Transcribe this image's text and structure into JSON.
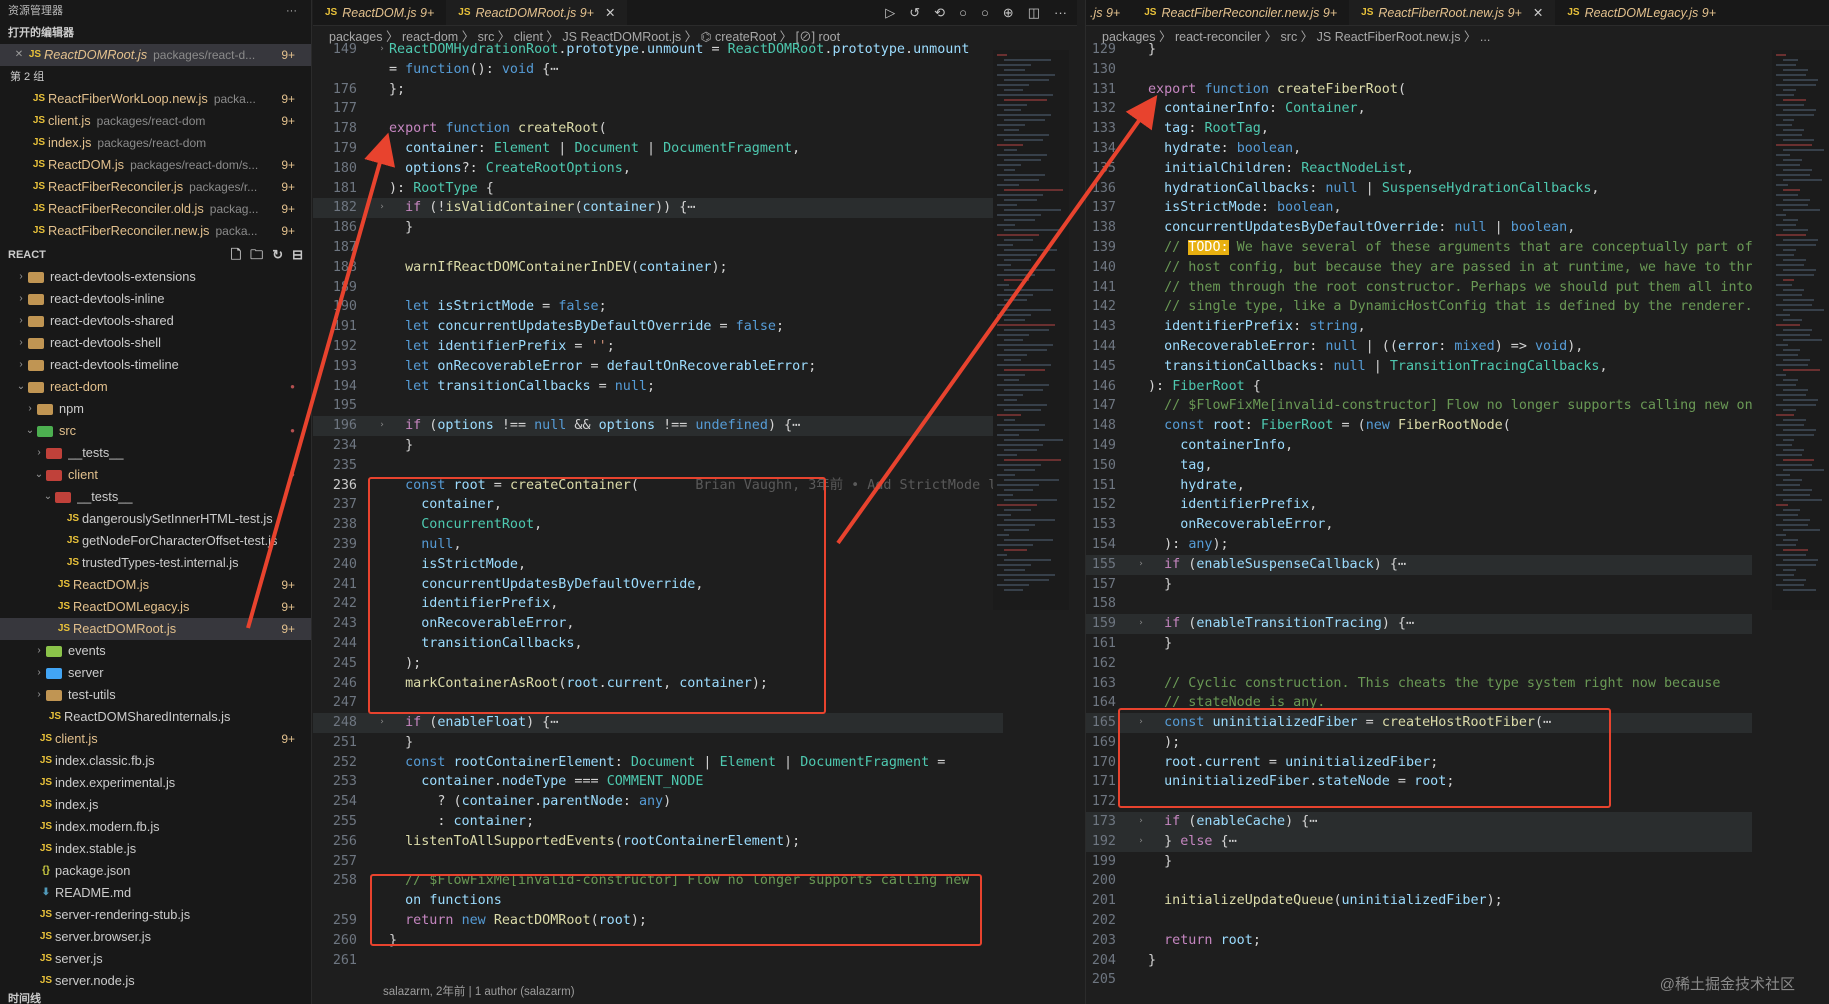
{
  "sidebar": {
    "explorer_title": "资源管理器",
    "more": "···",
    "open_editors_title": "打开的编辑器",
    "group_label": "第 2 组",
    "open_editors": [
      {
        "name": "ReactDOMRoot.js",
        "desc": "packages/react-d...",
        "badge": "9+",
        "icon": "JS",
        "closeable": true
      },
      {
        "name": "ReactFiberWorkLoop.new.js",
        "desc": "packa...",
        "badge": "9+",
        "icon": "JS"
      },
      {
        "name": "client.js",
        "desc": "packages/react-dom",
        "badge": "9+",
        "icon": "JS"
      },
      {
        "name": "index.js",
        "desc": "packages/react-dom",
        "badge": "",
        "icon": "JS"
      },
      {
        "name": "ReactDOM.js",
        "desc": "packages/react-dom/s...",
        "badge": "9+",
        "icon": "JS"
      },
      {
        "name": "ReactFiberReconciler.js",
        "desc": "packages/r...",
        "badge": "9+",
        "icon": "JS"
      },
      {
        "name": "ReactFiberReconciler.old.js",
        "desc": "packag...",
        "badge": "9+",
        "icon": "JS"
      },
      {
        "name": "ReactFiberReconciler.new.js",
        "desc": "packa...",
        "badge": "9+",
        "icon": "JS"
      }
    ],
    "project_title": "REACT",
    "tree": [
      {
        "name": "react-devtools-extensions",
        "kind": "folder",
        "chev": "›",
        "indent": 0
      },
      {
        "name": "react-devtools-inline",
        "kind": "folder",
        "chev": "›",
        "indent": 0
      },
      {
        "name": "react-devtools-shared",
        "kind": "folder",
        "chev": "›",
        "indent": 0
      },
      {
        "name": "react-devtools-shell",
        "kind": "folder",
        "chev": "›",
        "indent": 0
      },
      {
        "name": "react-devtools-timeline",
        "kind": "folder",
        "chev": "›",
        "indent": 0
      },
      {
        "name": "react-dom",
        "kind": "folder",
        "chev": "⌄",
        "indent": 0,
        "mod": true
      },
      {
        "name": "npm",
        "kind": "folder",
        "chev": "›",
        "indent": 1
      },
      {
        "name": "src",
        "kind": "folder",
        "chev": "⌄",
        "indent": 1,
        "mod": true
      },
      {
        "name": "__tests__",
        "kind": "folder",
        "chev": "›",
        "indent": 2
      },
      {
        "name": "client",
        "kind": "folder",
        "chev": "⌄",
        "indent": 2,
        "mod": true
      },
      {
        "name": "__tests__",
        "kind": "folder",
        "chev": "⌄",
        "indent": 3
      },
      {
        "name": "dangerouslySetInnerHTML-test.js",
        "kind": "file",
        "indent": 4
      },
      {
        "name": "getNodeForCharacterOffset-test.js",
        "kind": "file",
        "indent": 4
      },
      {
        "name": "trustedTypes-test.internal.js",
        "kind": "file",
        "indent": 4
      },
      {
        "name": "ReactDOM.js",
        "kind": "file",
        "indent": 3,
        "badge": "9+",
        "mod": true
      },
      {
        "name": "ReactDOMLegacy.js",
        "kind": "file",
        "indent": 3,
        "badge": "9+",
        "mod": true
      },
      {
        "name": "ReactDOMRoot.js",
        "kind": "file",
        "indent": 3,
        "badge": "9+",
        "mod": true,
        "selected": true
      },
      {
        "name": "events",
        "kind": "folder",
        "chev": "›",
        "indent": 2
      },
      {
        "name": "server",
        "kind": "folder",
        "chev": "›",
        "indent": 2
      },
      {
        "name": "test-utils",
        "kind": "folder",
        "chev": "›",
        "indent": 2
      },
      {
        "name": "ReactDOMSharedInternals.js",
        "kind": "file",
        "indent": 2
      },
      {
        "name": "client.js",
        "kind": "file",
        "indent": 1,
        "badge": "9+",
        "mod": true
      },
      {
        "name": "index.classic.fb.js",
        "kind": "file",
        "indent": 1
      },
      {
        "name": "index.experimental.js",
        "kind": "file",
        "indent": 1
      },
      {
        "name": "index.js",
        "kind": "file",
        "indent": 1
      },
      {
        "name": "index.modern.fb.js",
        "kind": "file",
        "indent": 1
      },
      {
        "name": "index.stable.js",
        "kind": "file",
        "indent": 1
      },
      {
        "name": "package.json",
        "kind": "json",
        "indent": 1
      },
      {
        "name": "README.md",
        "kind": "md",
        "indent": 1
      },
      {
        "name": "server-rendering-stub.js",
        "kind": "file",
        "indent": 1
      },
      {
        "name": "server.browser.js",
        "kind": "file",
        "indent": 1
      },
      {
        "name": "server.js",
        "kind": "file",
        "indent": 1
      },
      {
        "name": "server.node.js",
        "kind": "file",
        "indent": 1
      }
    ],
    "timeline_title": "时间线"
  },
  "left_editor": {
    "tabs": [
      {
        "label": "ReactDOM.js 9+",
        "active": false
      },
      {
        "label": "ReactDOMRoot.js 9+",
        "active": true,
        "close": "✕"
      }
    ],
    "breadcrumb": "packages 〉 react-dom 〉 src 〉 client 〉 JS ReactDOMRoot.js 〉 ⌬ createRoot 〉 [⊘] root",
    "lines": [
      {
        "n": "149",
        "fold": "›",
        "t": "ReactDOMHydrationRoot.prototype.unmount = ReactDOMRoot.prototype.unmount"
      },
      {
        "n": "",
        "t": "= function(): void {⋯"
      },
      {
        "n": "176",
        "t": "};"
      },
      {
        "n": "177",
        "t": ""
      },
      {
        "n": "178",
        "t": "export function createRoot("
      },
      {
        "n": "179",
        "t": "  container: Element | Document | DocumentFragment,"
      },
      {
        "n": "180",
        "t": "  options?: CreateRootOptions,"
      },
      {
        "n": "181",
        "t": "): RootType {"
      },
      {
        "n": "182",
        "fold": "›",
        "t": "  if (!isValidContainer(container)) {⋯",
        "hl": true
      },
      {
        "n": "186",
        "t": "  }"
      },
      {
        "n": "187",
        "t": ""
      },
      {
        "n": "188",
        "t": "  warnIfReactDOMContainerInDEV(container);"
      },
      {
        "n": "189",
        "t": ""
      },
      {
        "n": "190",
        "t": "  let isStrictMode = false;"
      },
      {
        "n": "191",
        "t": "  let concurrentUpdatesByDefaultOverride = false;"
      },
      {
        "n": "192",
        "t": "  let identifierPrefix = '';"
      },
      {
        "n": "193",
        "t": "  let onRecoverableError = defaultOnRecoverableError;"
      },
      {
        "n": "194",
        "t": "  let transitionCallbacks = null;"
      },
      {
        "n": "195",
        "t": ""
      },
      {
        "n": "196",
        "fold": "›",
        "t": "  if (options !== null && options !== undefined) {⋯",
        "hl": true
      },
      {
        "n": "234",
        "t": "  }"
      },
      {
        "n": "235",
        "t": ""
      },
      {
        "n": "236",
        "cur": true,
        "t": "  const root = createContainer(       Brian Vaughn, 3年前 • Add StrictMode l"
      },
      {
        "n": "237",
        "t": "    container,"
      },
      {
        "n": "238",
        "t": "    ConcurrentRoot,"
      },
      {
        "n": "239",
        "t": "    null,"
      },
      {
        "n": "240",
        "t": "    isStrictMode,"
      },
      {
        "n": "241",
        "t": "    concurrentUpdatesByDefaultOverride,"
      },
      {
        "n": "242",
        "t": "    identifierPrefix,"
      },
      {
        "n": "243",
        "t": "    onRecoverableError,"
      },
      {
        "n": "244",
        "t": "    transitionCallbacks,"
      },
      {
        "n": "245",
        "t": "  );"
      },
      {
        "n": "246",
        "t": "  markContainerAsRoot(root.current, container);"
      },
      {
        "n": "247",
        "t": ""
      },
      {
        "n": "248",
        "fold": "›",
        "t": "  if (enableFloat) {⋯",
        "hl": true
      },
      {
        "n": "251",
        "t": "  }"
      },
      {
        "n": "252",
        "t": "  const rootContainerElement: Document | Element | DocumentFragment ="
      },
      {
        "n": "253",
        "t": "    container.nodeType === COMMENT_NODE"
      },
      {
        "n": "254",
        "t": "      ? (container.parentNode: any)"
      },
      {
        "n": "255",
        "t": "      : container;"
      },
      {
        "n": "256",
        "t": "  listenToAllSupportedEvents(rootContainerElement);"
      },
      {
        "n": "257",
        "t": ""
      },
      {
        "n": "258",
        "t": "  // $FlowFixMe[invalid-constructor] Flow no longer supports calling new"
      },
      {
        "n": "",
        "t": "  on functions"
      },
      {
        "n": "259",
        "t": "  return new ReactDOMRoot(root);"
      },
      {
        "n": "260",
        "t": "}"
      },
      {
        "n": "261",
        "t": ""
      }
    ],
    "blame_status": "salazarm, 2年前 | 1 author (salazarm)"
  },
  "right_editor": {
    "tabs": [
      {
        "label": ".js 9+",
        "active": false
      },
      {
        "label": "ReactFiberReconciler.new.js 9+",
        "active": false
      },
      {
        "label": "ReactFiberRoot.new.js 9+",
        "active": true,
        "close": "✕"
      },
      {
        "label": "ReactDOMLegacy.js 9+",
        "active": false
      }
    ],
    "breadcrumb": "packages 〉 react-reconciler 〉 src 〉 JS ReactFiberRoot.new.js 〉 ...",
    "lines": [
      {
        "n": "129",
        "t": "}"
      },
      {
        "n": "130",
        "t": ""
      },
      {
        "n": "131",
        "t": "export function createFiberRoot("
      },
      {
        "n": "132",
        "t": "  containerInfo: Container,"
      },
      {
        "n": "133",
        "t": "  tag: RootTag,"
      },
      {
        "n": "134",
        "t": "  hydrate: boolean,"
      },
      {
        "n": "135",
        "t": "  initialChildren: ReactNodeList,"
      },
      {
        "n": "136",
        "t": "  hydrationCallbacks: null | SuspenseHydrationCallbacks,"
      },
      {
        "n": "137",
        "t": "  isStrictMode: boolean,"
      },
      {
        "n": "138",
        "t": "  concurrentUpdatesByDefaultOverride: null | boolean,"
      },
      {
        "n": "139",
        "t": "  // TODO: We have several of these arguments that are conceptually part of"
      },
      {
        "n": "140",
        "t": "  // host config, but because they are passed in at runtime, we have to thr"
      },
      {
        "n": "141",
        "t": "  // them through the root constructor. Perhaps we should put them all into"
      },
      {
        "n": "142",
        "t": "  // single type, like a DynamicHostConfig that is defined by the renderer."
      },
      {
        "n": "143",
        "t": "  identifierPrefix: string,"
      },
      {
        "n": "144",
        "t": "  onRecoverableError: null | ((error: mixed) => void),"
      },
      {
        "n": "145",
        "t": "  transitionCallbacks: null | TransitionTracingCallbacks,"
      },
      {
        "n": "146",
        "t": "): FiberRoot {"
      },
      {
        "n": "147",
        "t": "  // $FlowFixMe[invalid-constructor] Flow no longer supports calling new on"
      },
      {
        "n": "148",
        "t": "  const root: FiberRoot = (new FiberRootNode("
      },
      {
        "n": "149",
        "t": "    containerInfo,"
      },
      {
        "n": "150",
        "t": "    tag,"
      },
      {
        "n": "151",
        "t": "    hydrate,"
      },
      {
        "n": "152",
        "t": "    identifierPrefix,"
      },
      {
        "n": "153",
        "t": "    onRecoverableError,"
      },
      {
        "n": "154",
        "t": "  ): any);"
      },
      {
        "n": "155",
        "fold": "›",
        "t": "  if (enableSuspenseCallback) {⋯",
        "hl": true
      },
      {
        "n": "157",
        "t": "  }"
      },
      {
        "n": "158",
        "t": ""
      },
      {
        "n": "159",
        "fold": "›",
        "t": "  if (enableTransitionTracing) {⋯",
        "hl": true
      },
      {
        "n": "161",
        "t": "  }"
      },
      {
        "n": "162",
        "t": ""
      },
      {
        "n": "163",
        "t": "  // Cyclic construction. This cheats the type system right now because"
      },
      {
        "n": "164",
        "t": "  // stateNode is any."
      },
      {
        "n": "165",
        "fold": "›",
        "t": "  const uninitializedFiber = createHostRootFiber(⋯",
        "hl": true
      },
      {
        "n": "169",
        "t": "  );"
      },
      {
        "n": "170",
        "t": "  root.current = uninitializedFiber;"
      },
      {
        "n": "171",
        "t": "  uninitializedFiber.stateNode = root;"
      },
      {
        "n": "172",
        "t": ""
      },
      {
        "n": "173",
        "fold": "›",
        "t": "  if (enableCache) {⋯",
        "hl": true
      },
      {
        "n": "192",
        "fold": "›",
        "t": "  } else {⋯",
        "hl": true
      },
      {
        "n": "199",
        "t": "  }"
      },
      {
        "n": "200",
        "t": ""
      },
      {
        "n": "201",
        "t": "  initializeUpdateQueue(uninitializedFiber);"
      },
      {
        "n": "202",
        "t": ""
      },
      {
        "n": "203",
        "t": "  return root;"
      },
      {
        "n": "204",
        "t": "}"
      },
      {
        "n": "205",
        "t": ""
      }
    ]
  },
  "watermark": "@稀土掘金技术社区",
  "colors": {
    "keyword": "#c586c0",
    "storage": "#569cd6",
    "function": "#dcdcaa",
    "type": "#4ec9b0",
    "variable": "#9cdcfe",
    "comment": "#6a9955",
    "string": "#ce9178",
    "annotation": "#e8432e"
  }
}
